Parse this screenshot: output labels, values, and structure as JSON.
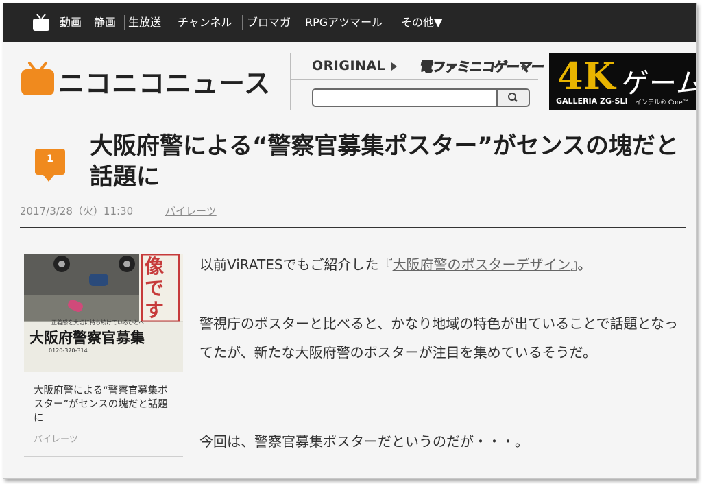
{
  "nav": {
    "items": [
      "動画",
      "静画",
      "生放送",
      "チャンネル",
      "ブロマガ",
      "RPGアツマール",
      "その他▼"
    ]
  },
  "header": {
    "logo_text": "ニコニコニュース",
    "original_label": "ORIGINAL",
    "famicom_label": "電ファミニコゲーマー",
    "search": {
      "placeholder": ""
    },
    "ad": {
      "big": "4K",
      "kana": "ゲーム",
      "sub": "GALLERIA ZG-SLI",
      "sub2": "インテル® Core™"
    }
  },
  "article": {
    "badge": "1",
    "title": "大阪府警による“警察官募集ポスター”がセンスの塊だと話題に",
    "date": "2017/3/28（火）11:30",
    "source": "バイレーツ",
    "paragraphs": {
      "p1_before": "以前ViRATESでもご紹介した『",
      "p1_link": "大阪府警のポスターデザイン",
      "p1_after": "』。",
      "p2": "警視庁のポスターと比べると、かなり地域の特色が出ていることで話題となってたが、新たな大阪府警のポスターが注目を集めているそうだ。",
      "p3": "今回は、警察官募集ポスターだというのだが・・・。"
    }
  },
  "sidebar_card": {
    "image_text_top": "像です",
    "image_caption": "正義感を大切に持ち続けているひとへ",
    "image_heading": "大阪府警察官募集",
    "image_phone": "0120-370-314",
    "title": "大阪府警による“警察官募集ポスター”がセンスの塊だと話題に",
    "source": "バイレーツ"
  },
  "colors": {
    "nav_bg": "#262626",
    "accent_orange": "#f08a1e",
    "ad_gold": "#e8b400"
  }
}
